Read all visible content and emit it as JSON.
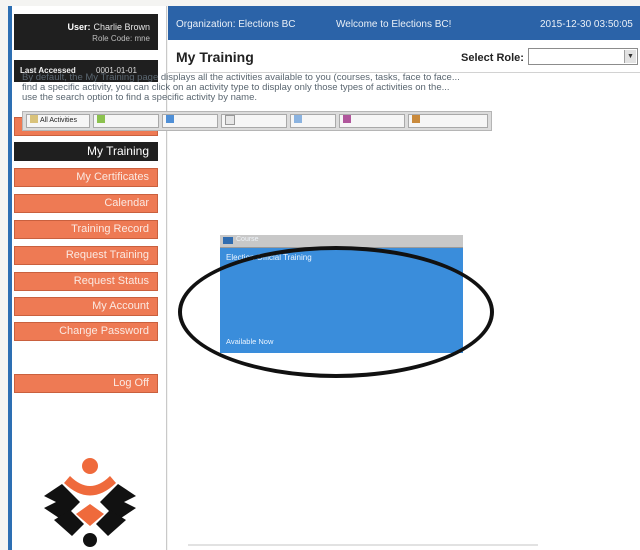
{
  "user": {
    "user_label": "User:",
    "user_name": "Charlie Brown",
    "role_code_label": "Role Code:",
    "role_code_value": "mne",
    "last_accessed_label": "Last Accessed",
    "last_accessed_value": "0001-01-01"
  },
  "nav": {
    "items": [
      {
        "label": "Home"
      },
      {
        "label": "My Training"
      },
      {
        "label": "My Certificates"
      },
      {
        "label": "Calendar"
      },
      {
        "label": "Training Record"
      },
      {
        "label": "Request Training"
      },
      {
        "label": "Request Status"
      },
      {
        "label": "My Account"
      },
      {
        "label": "Change Password"
      }
    ],
    "active_index": 1,
    "logout_label": "Log Off"
  },
  "topbar": {
    "organization": "Organization: Elections BC",
    "welcome": "Welcome to Elections BC!",
    "timestamp": "2015-12-30 03:50:05"
  },
  "page": {
    "title": "My Training",
    "role_label": "Select Role:",
    "role_value": "",
    "description": "By default, the My Training page displays all the activities available to you (courses, tasks, face to face...\nfind a specific activity, you can click on an activity type to display only those types of activities on the...\nuse the search option to find a specific activity by name."
  },
  "filters": [
    {
      "label": "All Activities",
      "icon": "list-icon"
    },
    {
      "label": "",
      "icon": "course-icon"
    },
    {
      "label": "",
      "icon": "monitor-icon"
    },
    {
      "label": "",
      "icon": "document-icon"
    },
    {
      "label": "",
      "icon": "chart-icon"
    },
    {
      "label": "",
      "icon": "gear-icon"
    },
    {
      "label": "",
      "icon": "box-icon"
    }
  ],
  "activity_card": {
    "header": "Course",
    "title": "Election Official Training",
    "status": "Available Now"
  },
  "colors": {
    "nav_orange": "#ee7a54",
    "topbar_blue": "#2b63a8",
    "card_blue": "#3a8ddb",
    "logo_orange": "#ef6a3c"
  }
}
